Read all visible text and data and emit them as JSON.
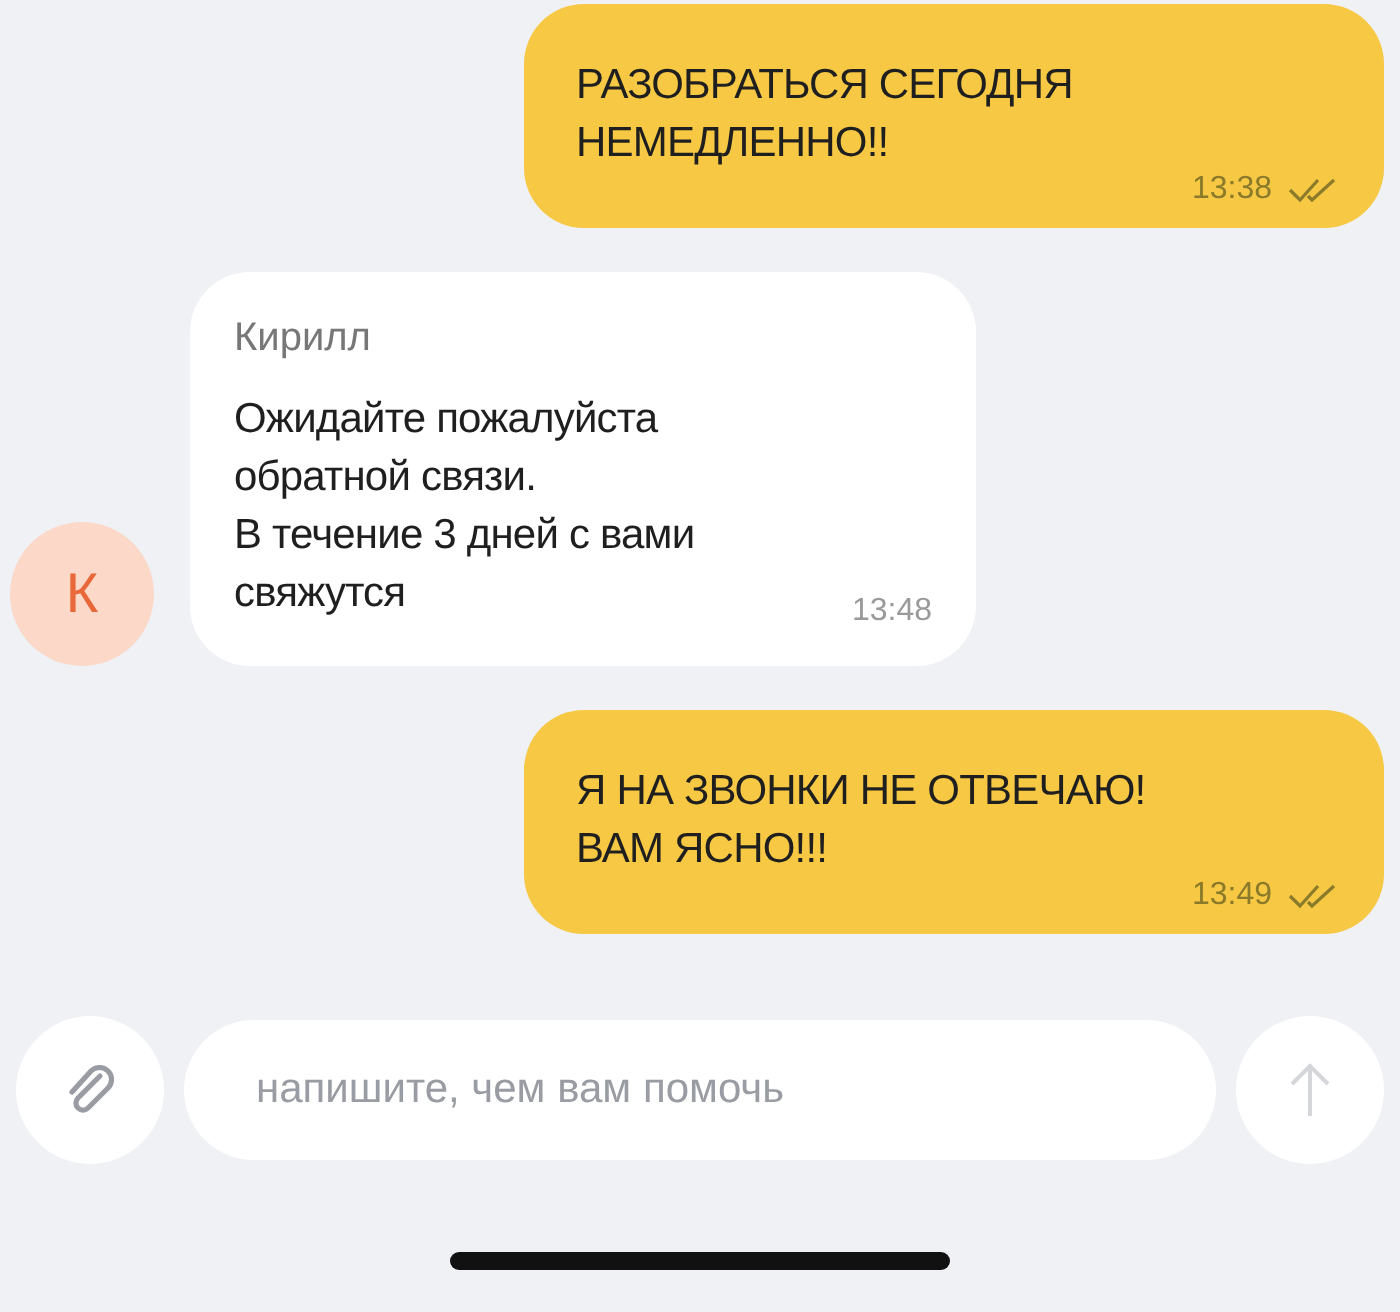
{
  "messages": [
    {
      "kind": "outgoing",
      "lines": [
        "РАЗОБРАТЬСЯ СЕГОДНЯ",
        "НЕМЕДЛЕННО!!"
      ],
      "time": "13:38",
      "read": true
    },
    {
      "kind": "incoming",
      "sender": "Кирилл",
      "avatar": "К",
      "lines": [
        "Ожидайте пожалуйста",
        "обратной связи.",
        "В течение 3 дней с вами",
        "свяжутся"
      ],
      "time": "13:48"
    },
    {
      "kind": "outgoing",
      "lines": [
        "Я НА ЗВОНКИ НЕ ОТВЕЧАЮ!",
        "ВАМ ЯСНО!!!"
      ],
      "time": "13:49",
      "read": true
    }
  ],
  "composer": {
    "placeholder": "напишите, чем вам помочь"
  }
}
